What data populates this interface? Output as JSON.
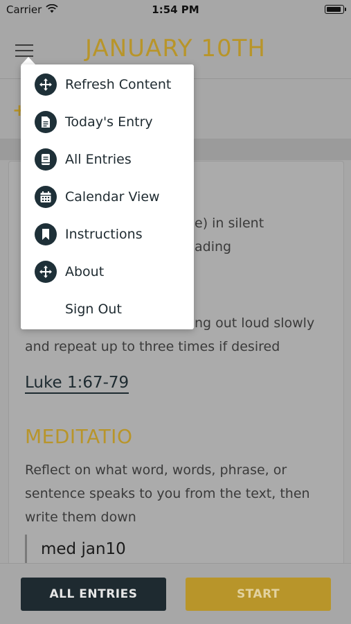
{
  "status_bar": {
    "carrier": "Carrier",
    "time": "1:54 PM"
  },
  "header": {
    "title": "JANUARY 10TH"
  },
  "subbar": {
    "plus": "+"
  },
  "card": {
    "lectio_line1_tail": "e) in silent",
    "lectio_line2_tail": "ading",
    "lectio_line3_tail": "ng out loud slowly",
    "lectio_line4": "and repeat up to three times if desired",
    "scripture_link": "Luke 1:67-79",
    "meditatio_heading": "MEDITATIO",
    "meditatio_text": "Reflect on what word, words, phrase, or sentence speaks to you from the text, then write them down",
    "quote": "med jan10"
  },
  "bottom": {
    "all_entries_label": "ALL ENTRIES",
    "start_label": "START"
  },
  "menu": {
    "items": [
      {
        "label": "Refresh Content",
        "icon": "move-arrows-icon"
      },
      {
        "label": "Today's Entry",
        "icon": "document-icon"
      },
      {
        "label": "All Entries",
        "icon": "book-icon"
      },
      {
        "label": "Calendar View",
        "icon": "calendar-icon"
      },
      {
        "label": "Instructions",
        "icon": "bookmark-icon"
      },
      {
        "label": "About",
        "icon": "move-arrows-icon"
      },
      {
        "label": "Sign Out",
        "icon": ""
      }
    ]
  },
  "colors": {
    "accent_gold": "#b8952a",
    "dark_navy": "#1e2a30",
    "overlay_gray": "#a7a7a7"
  }
}
